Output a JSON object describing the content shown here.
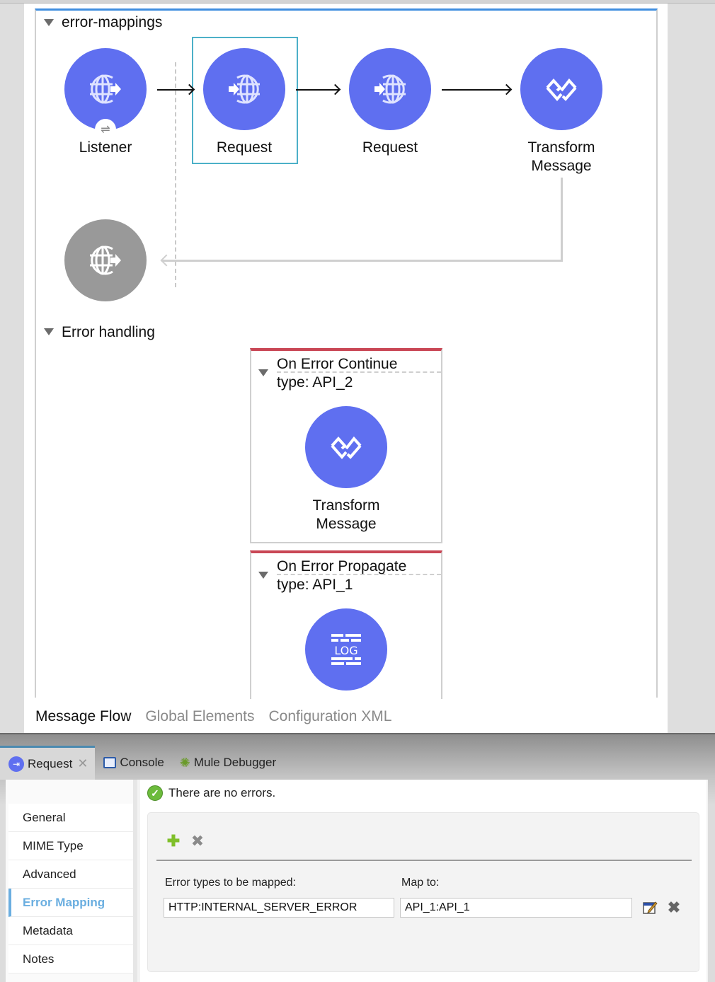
{
  "flow": {
    "name": "error-mappings",
    "nodes": [
      {
        "label": "Listener",
        "icon": "http-listener-icon"
      },
      {
        "label": "Request",
        "icon": "http-request-icon",
        "selected": true
      },
      {
        "label": "Request",
        "icon": "http-request-icon"
      },
      {
        "label_line1": "Transform",
        "label_line2": "Message",
        "icon": "transform-message-icon"
      }
    ],
    "listener_badge": "⇌",
    "response_icon": "http-listener-response-icon"
  },
  "error_handling": {
    "title": "Error handling",
    "handlers": [
      {
        "title": "On Error Continue",
        "type": "type: API_2",
        "component_line1": "Transform",
        "component_line2": "Message",
        "icon": "transform-message-icon"
      },
      {
        "title": "On Error Propagate",
        "type": "type: API_1",
        "component_icon_text": "LOG",
        "icon": "logger-icon"
      }
    ]
  },
  "editor_tabs": [
    {
      "label": "Message Flow",
      "active": true
    },
    {
      "label": "Global Elements",
      "active": false
    },
    {
      "label": "Configuration XML",
      "active": false
    }
  ],
  "view_tabs": [
    {
      "label": "Request",
      "active": true,
      "closable": true
    },
    {
      "label": "Console",
      "active": false
    },
    {
      "label": "Mule Debugger",
      "active": false
    }
  ],
  "properties": {
    "nav": [
      "General",
      "MIME Type",
      "Advanced",
      "Error Mapping",
      "Metadata",
      "Notes"
    ],
    "active_nav": "Error Mapping",
    "status": "There are no errors.",
    "columns": {
      "source": "Error types to be mapped:",
      "target": "Map to:"
    },
    "mapping": {
      "source": "HTTP:INTERNAL_SERVER_ERROR",
      "target": "API_1:API_1"
    }
  },
  "colors": {
    "node": "#5f6ff0",
    "selection": "#4cb0c8",
    "flow_header": "#3f8ee0",
    "error_header": "#c94755",
    "active_nav": "#6aaee0"
  }
}
